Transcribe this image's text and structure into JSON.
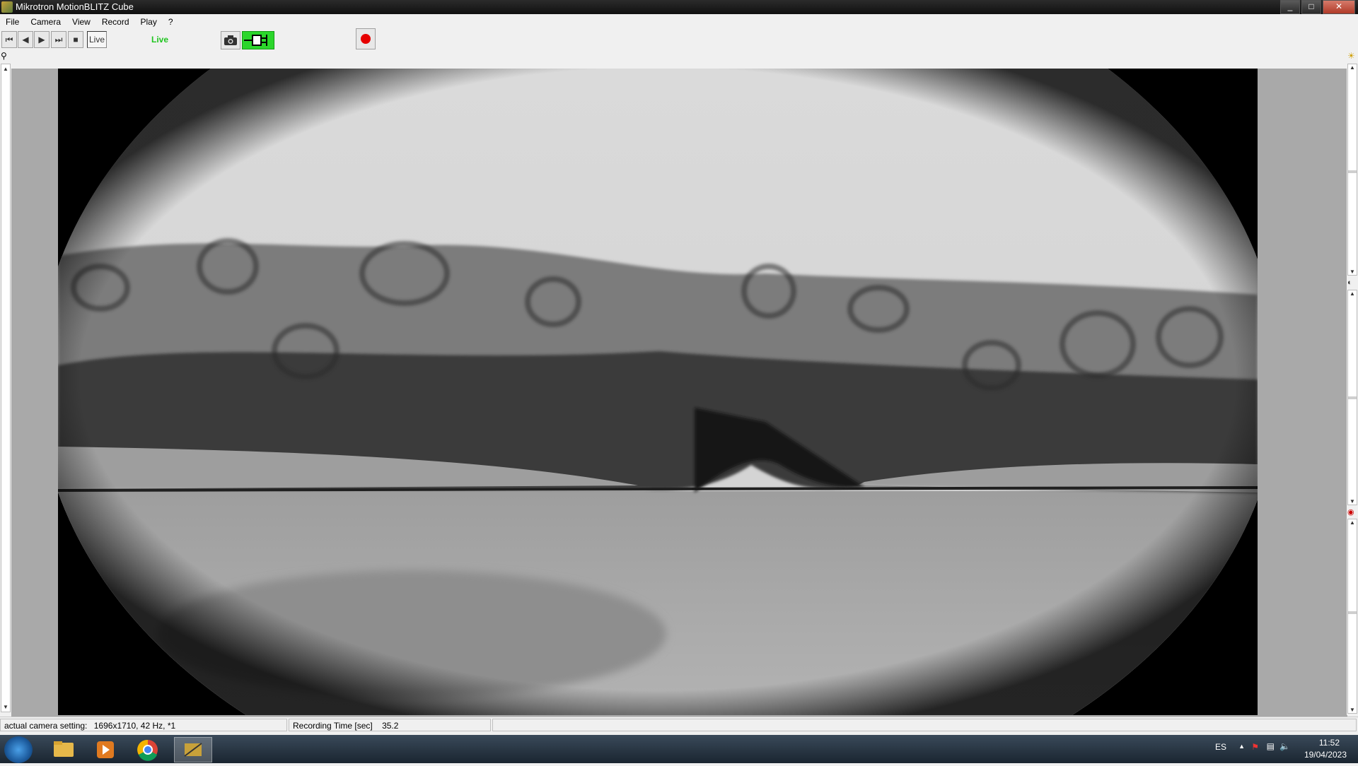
{
  "window": {
    "title": "Mikrotron MotionBLITZ Cube",
    "controls": [
      "minimize",
      "maximize",
      "close"
    ]
  },
  "menu": [
    "File",
    "Camera",
    "View",
    "Record",
    "Play",
    "?"
  ],
  "toolbar": {
    "playback_buttons": [
      {
        "name": "rewind-to-start-button",
        "icon": "skip-back-icon",
        "glyph": "⏮"
      },
      {
        "name": "step-back-button",
        "icon": "step-back-icon",
        "glyph": "◀"
      },
      {
        "name": "play-button",
        "icon": "play-icon",
        "glyph": "▶"
      },
      {
        "name": "skip-to-end-button",
        "icon": "skip-forward-icon",
        "glyph": "⏭"
      },
      {
        "name": "stop-button",
        "icon": "stop-icon",
        "glyph": "■"
      }
    ],
    "live_button_label": "Live",
    "live_status": "Live",
    "live_status_color": "#1ec51e",
    "snapshot_icon": "camera-icon",
    "connection_icon": "plug-icon",
    "connection_color": "#2bd62b",
    "record_icon": "record-icon",
    "record_color": "#e60000"
  },
  "left_panel": {
    "zoom_icon": "magnifier-icon"
  },
  "right_panel": {
    "brightness_icon": "sun-icon",
    "contrast_icon": "contrast-icon",
    "gain_icon": "gain-icon"
  },
  "status": {
    "camera_setting_label": "actual camera setting:",
    "camera_setting_value": "1696x1710, 42 Hz, *1",
    "recording_time_label": "Recording Time [sec]",
    "recording_time_value": "35.2"
  },
  "taskbar": {
    "apps": [
      "start-icon",
      "file-explorer-icon",
      "media-player-icon",
      "chrome-icon",
      "motionblitz-icon"
    ],
    "language": "ES",
    "time": "11:52",
    "date": "19/04/2023"
  }
}
